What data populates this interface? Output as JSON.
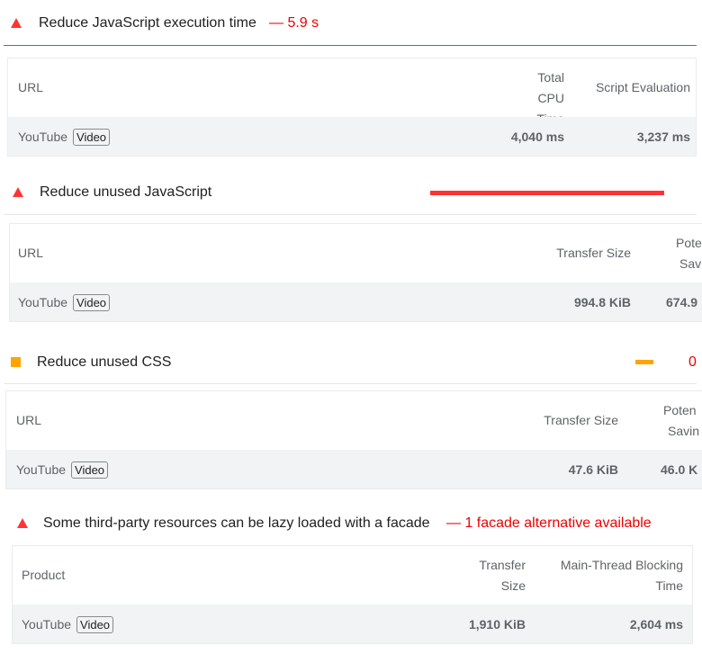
{
  "audits": [
    {
      "title": "Reduce JavaScript execution time",
      "display_value": "— 5.9 s",
      "headers": [
        "URL",
        "Total CPU Time",
        "Script Evaluation"
      ],
      "rows": [
        {
          "url": "YouTube",
          "badge": "Video",
          "values": [
            "4,040 ms",
            "3,237 ms"
          ]
        }
      ]
    },
    {
      "title": "Reduce unused JavaScript",
      "savings_bar_fraction": 1.0,
      "headers": [
        "URL",
        "Transfer Size",
        "Pote",
        "Sav"
      ],
      "rows": [
        {
          "url": "YouTube",
          "badge": "Video",
          "values": [
            "994.8 KiB",
            "674.9"
          ]
        }
      ]
    },
    {
      "title": "Reduce unused CSS",
      "display_value": "0",
      "savings_bar_fraction": 0.08,
      "headers": [
        "URL",
        "Transfer Size",
        "Poten",
        "Savin"
      ],
      "rows": [
        {
          "url": "YouTube",
          "badge": "Video",
          "values": [
            "47.6 KiB",
            "46.0 K"
          ]
        }
      ]
    },
    {
      "title": "Some third-party resources can be lazy loaded with a facade",
      "display_value": "— 1 facade alternative available",
      "headers": [
        "Product",
        "Transfer Size",
        "Main-Thread Blocking Time"
      ],
      "rows": [
        {
          "url": "YouTube",
          "badge": "Video",
          "values": [
            "1,910 KiB",
            "2,604 ms"
          ]
        }
      ]
    }
  ],
  "colors": {
    "fail": "#ff3333",
    "average": "#ffa400",
    "error_text": "#e00000",
    "row_alt": "#f1f3f4"
  },
  "icons": [
    "fail-triangle-icon",
    "average-square-icon"
  ]
}
